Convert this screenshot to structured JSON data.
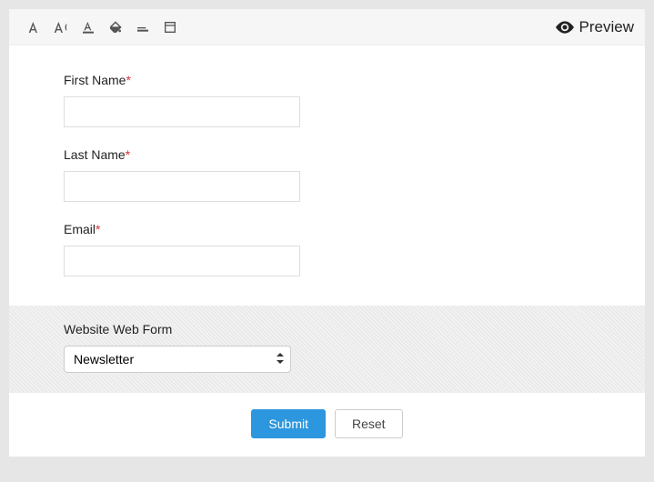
{
  "toolbar": {
    "preview_label": "Preview"
  },
  "fields": {
    "first_name": {
      "label": "First Name",
      "required": "*"
    },
    "last_name": {
      "label": "Last Name",
      "required": "*"
    },
    "email": {
      "label": "Email",
      "required": "*"
    },
    "website_form": {
      "label": "Website Web Form",
      "selected": "Newsletter"
    }
  },
  "actions": {
    "submit": "Submit",
    "reset": "Reset"
  }
}
